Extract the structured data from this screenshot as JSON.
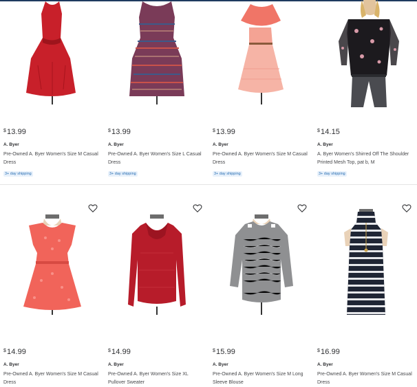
{
  "products": [
    {
      "price_cur": "$",
      "price_amt": "13.99",
      "brand": "A. Byer",
      "title": "Pre-Owned A. Byer Women's Size M Casual Dress",
      "shipping": "3+ day shipping",
      "fav": false,
      "image": "red-dress"
    },
    {
      "price_cur": "$",
      "price_amt": "13.99",
      "brand": "A. Byer",
      "title": "Pre-Owned A. Byer Women's Size L Casual Dress",
      "shipping": "3+ day shipping",
      "fav": false,
      "image": "printed-dress"
    },
    {
      "price_cur": "$",
      "price_amt": "13.99",
      "brand": "A. Byer",
      "title": "Pre-Owned A. Byer Women's Size M Casual Dress",
      "shipping": "3+ day shipping",
      "fav": false,
      "image": "coral-dress"
    },
    {
      "price_cur": "$",
      "price_amt": "14.15",
      "brand": "A. Byer",
      "title": "A. Byer Women's Shirred Off The Shoulder Printed Mesh Top, pat b, M",
      "shipping": "3+ day shipping",
      "fav": false,
      "image": "floral-top-model"
    },
    {
      "price_cur": "$",
      "price_amt": "14.99",
      "brand": "A. Byer",
      "title": "Pre-Owned A. Byer Women's Size M Casual Dress",
      "fav": true,
      "image": "coral-lace-dress"
    },
    {
      "price_cur": "$",
      "price_amt": "14.99",
      "brand": "A. Byer",
      "title": "Pre-Owned A. Byer Women's Size XL Pullover Sweater",
      "fav": true,
      "image": "red-sweater"
    },
    {
      "price_cur": "$",
      "price_amt": "15.99",
      "brand": "A. Byer",
      "title": "Pre-Owned A. Byer Women's Size M Long Sleeve Blouse",
      "fav": true,
      "image": "gray-blouse"
    },
    {
      "price_cur": "$",
      "price_amt": "16.99",
      "brand": "A. Byer",
      "title": "Pre-Owned A. Byer Women's Size M Casual Dress",
      "fav": true,
      "image": "striped-dress"
    }
  ],
  "colors": {
    "accent": "#1e3a5f",
    "shipping_bg": "#e8f1fb",
    "shipping_text": "#2a6fb3"
  }
}
